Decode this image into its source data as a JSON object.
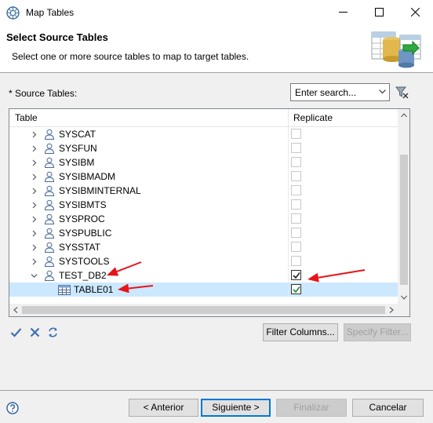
{
  "window": {
    "title": "Map Tables",
    "app_icon": "eclipse-icon",
    "minimize_icon": "minimize-icon",
    "maximize_icon": "maximize-icon",
    "close_icon": "close-icon"
  },
  "header": {
    "title": "Select Source Tables",
    "subtitle": "Select one or more source tables to map to target tables.",
    "image": "database-table-mapping-icon"
  },
  "source": {
    "label": "* Source Tables:",
    "search_value": "Enter search...",
    "clear_filter_icon": "clear-filter-icon"
  },
  "table": {
    "columns": [
      "Table",
      "Replicate"
    ],
    "rows": [
      {
        "name": "SYSCAT",
        "type": "schema",
        "expanded": false,
        "checked": false,
        "enabled": false
      },
      {
        "name": "SYSFUN",
        "type": "schema",
        "expanded": false,
        "checked": false,
        "enabled": false
      },
      {
        "name": "SYSIBM",
        "type": "schema",
        "expanded": false,
        "checked": false,
        "enabled": false
      },
      {
        "name": "SYSIBMADM",
        "type": "schema",
        "expanded": false,
        "checked": false,
        "enabled": false
      },
      {
        "name": "SYSIBMINTERNAL",
        "type": "schema",
        "expanded": false,
        "checked": false,
        "enabled": false
      },
      {
        "name": "SYSIBMTS",
        "type": "schema",
        "expanded": false,
        "checked": false,
        "enabled": false
      },
      {
        "name": "SYSPROC",
        "type": "schema",
        "expanded": false,
        "checked": false,
        "enabled": false
      },
      {
        "name": "SYSPUBLIC",
        "type": "schema",
        "expanded": false,
        "checked": false,
        "enabled": false
      },
      {
        "name": "SYSSTAT",
        "type": "schema",
        "expanded": false,
        "checked": false,
        "enabled": false
      },
      {
        "name": "SYSTOOLS",
        "type": "schema",
        "expanded": false,
        "checked": false,
        "enabled": false
      },
      {
        "name": "TEST_DB2",
        "type": "schema",
        "expanded": true,
        "checked": true,
        "enabled": true
      },
      {
        "name": "TABLE01",
        "type": "table",
        "expanded": false,
        "checked": true,
        "enabled": true,
        "selected": true
      }
    ]
  },
  "toolbar": {
    "select_all_icon": "check-all-icon",
    "deselect_all_icon": "uncheck-all-icon",
    "refresh_icon": "refresh-icon"
  },
  "buttons": {
    "filter_columns": "Filter Columns...",
    "specify_filter": "Specify Filter...",
    "back": "< Anterior",
    "next": "Siguiente >",
    "finish": "Finalizar",
    "cancel": "Cancelar"
  },
  "help_icon": "help-icon",
  "annotations": {
    "arrow_color": "#e8141b"
  }
}
